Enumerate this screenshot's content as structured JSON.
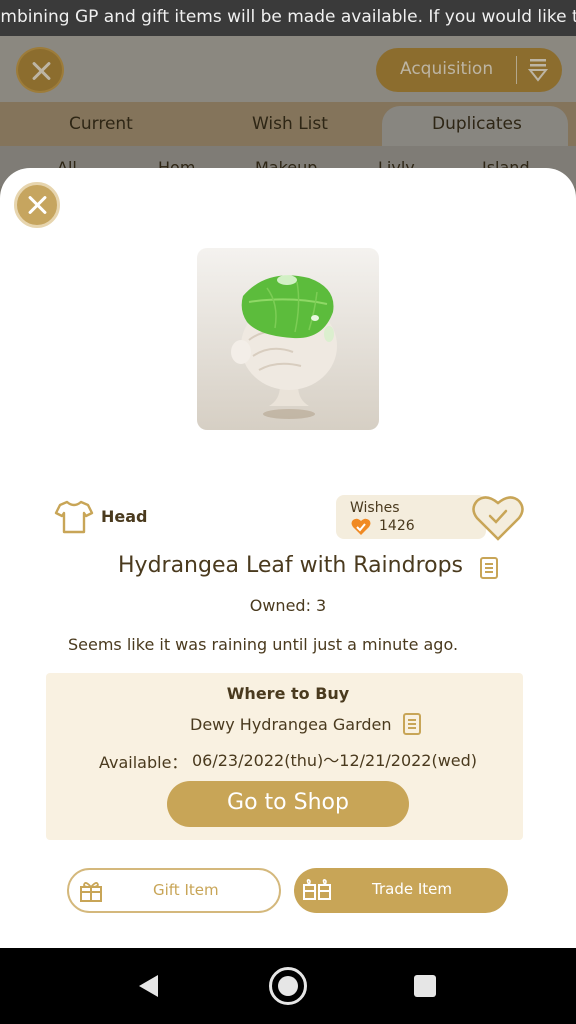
{
  "ticker": {
    "text": "ombining GP and gift items will be made available. If you would like to help"
  },
  "background": {
    "acquisition_label": "Acquisition",
    "tabs": [
      "Current",
      "Wish List",
      "Duplicates"
    ],
    "filters": [
      "All",
      "Hom",
      "Makeup",
      "Livly",
      "Island"
    ]
  },
  "item": {
    "category": "Head",
    "wishes_label": "Wishes",
    "wishes_count": "1426",
    "name": "Hydrangea Leaf with Raindrops",
    "owned": "Owned: 3",
    "description": "Seems like it was raining until just a minute ago."
  },
  "buy": {
    "title": "Where to Buy",
    "shop_name": "Dewy Hydrangea Garden",
    "available_label": "Available：",
    "available_range": "06/23/2022(thu)～12/21/2022(wed)",
    "goto_label": "Go to Shop"
  },
  "actions": {
    "gift_label": "Gift Item",
    "trade_label": "Trade Item"
  },
  "colors": {
    "accent_gold": "#c8a557",
    "text_brown": "#4a3a1e",
    "buy_box_bg": "#f9f1e1",
    "wish_heart": "#f08a24"
  },
  "icons": [
    "close-icon",
    "filter-icon",
    "shirt-icon",
    "heart-icon",
    "check-icon",
    "document-icon",
    "gift-icon",
    "trade-icon",
    "back-icon",
    "home-icon",
    "recents-icon"
  ]
}
